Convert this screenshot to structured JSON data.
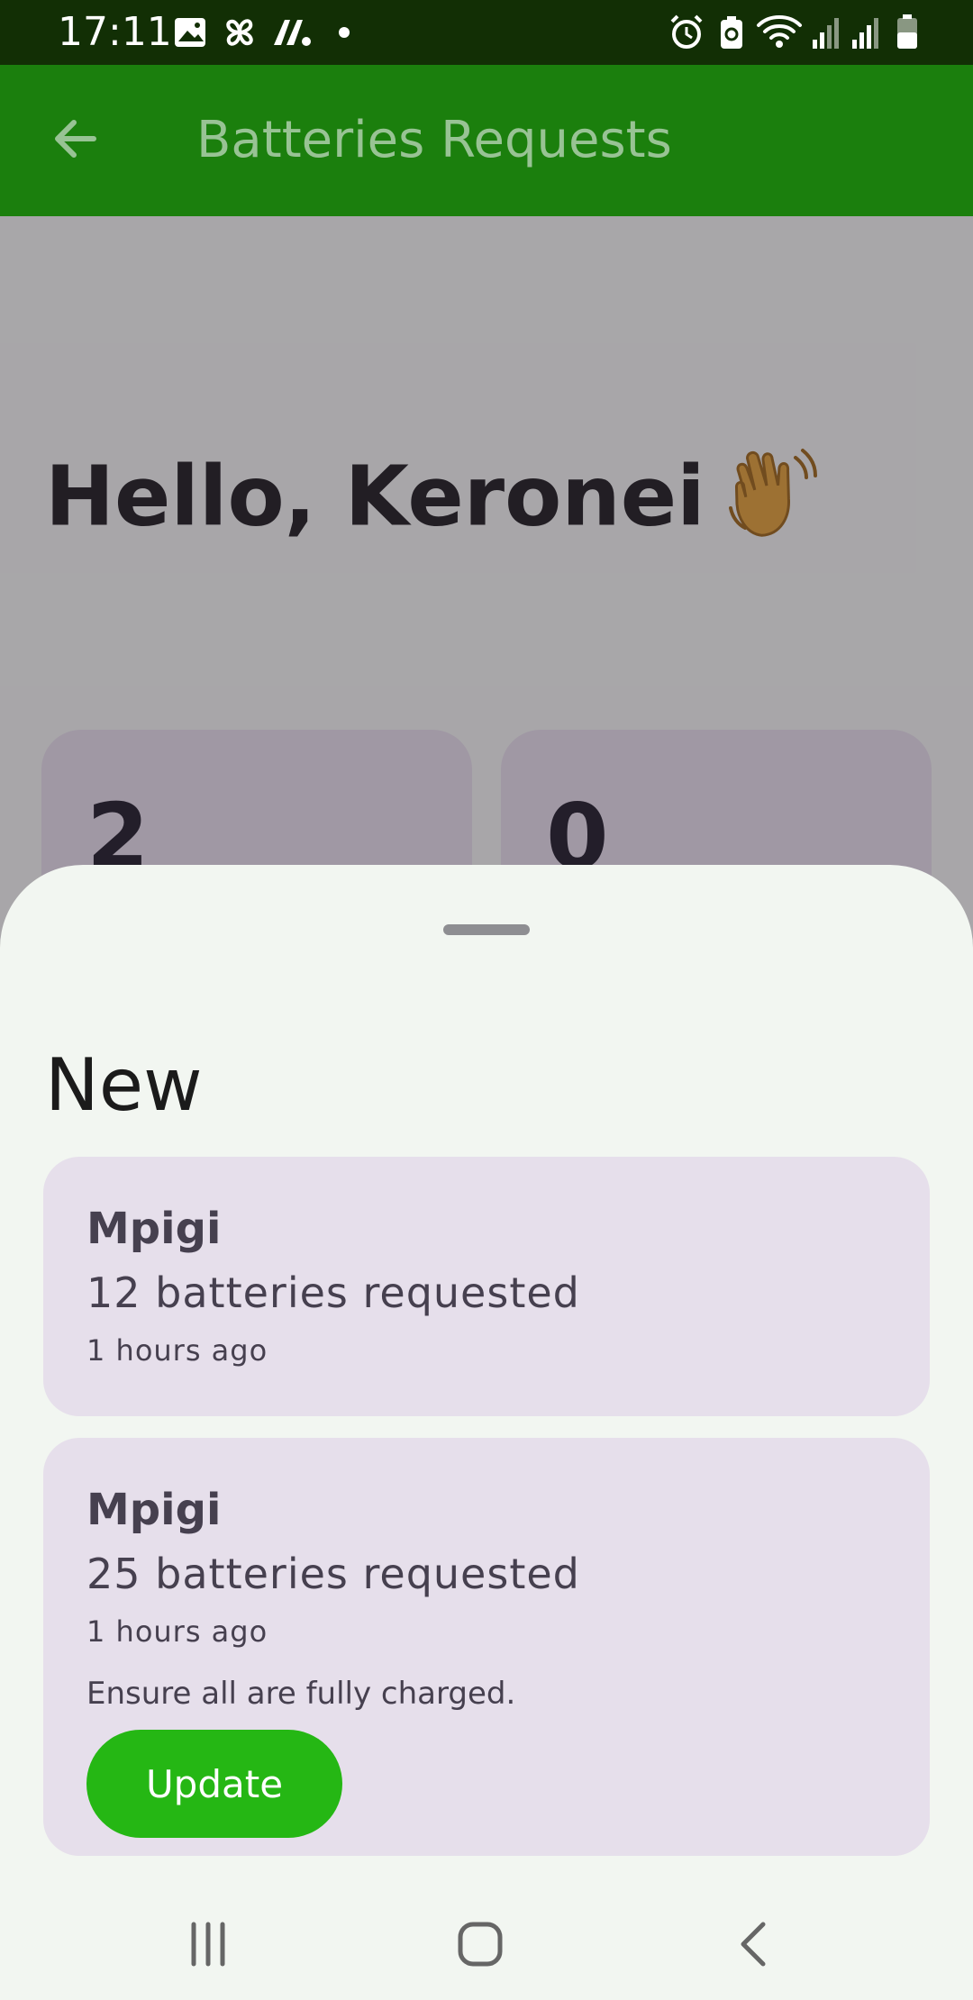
{
  "status_bar": {
    "time": "17:11",
    "left_icons": [
      "image-icon",
      "fan-icon",
      "app-icon",
      "dot-icon"
    ],
    "right_icons": [
      "alarm-icon",
      "battery-saver-icon",
      "wifi-icon",
      "signal-icon",
      "signal-icon",
      "battery-icon"
    ]
  },
  "app_bar": {
    "title": "Batteries Requests",
    "back_icon": "arrow-left-icon"
  },
  "page": {
    "greeting": "Hello, Keronei",
    "greeting_emoji": "waving-hand-icon",
    "stats": [
      {
        "value": "2"
      },
      {
        "value": "0"
      }
    ]
  },
  "sheet": {
    "section_title": "New",
    "requests": [
      {
        "location": "Mpigi",
        "count": "12 batteries requested",
        "time": "1 hours ago"
      },
      {
        "location": "Mpigi",
        "count": "25 batteries requested",
        "time": "1 hours ago",
        "note": "Ensure all are fully charged.",
        "action": "Update"
      }
    ]
  },
  "nav_bar": {
    "buttons": [
      "recents-icon",
      "home-icon",
      "back-icon"
    ]
  },
  "colors": {
    "status_bar": "#122f05",
    "app_bar": "#1b7f0d",
    "app_title": "#98c394",
    "sheet_bg": "#f2f6f1",
    "card_bg": "#e6dfeb",
    "update_button": "#25b714"
  }
}
